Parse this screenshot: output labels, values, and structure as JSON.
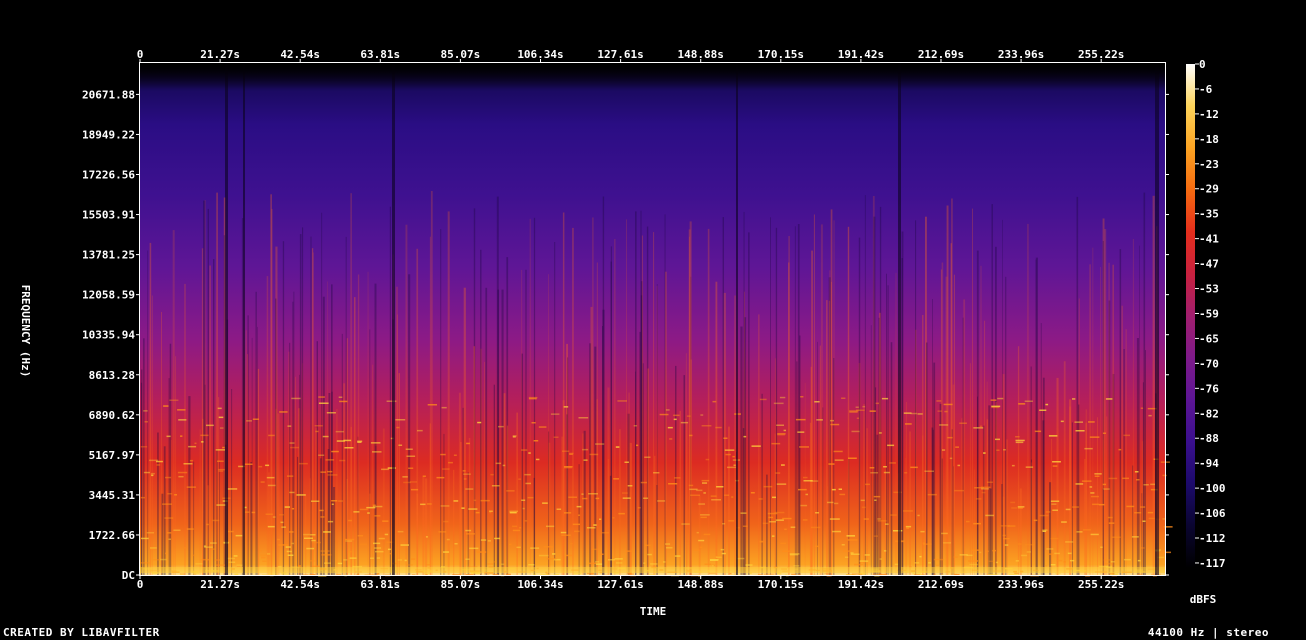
{
  "chart_data": {
    "type": "heatmap",
    "subtype": "spectrogram",
    "xlabel": "TIME",
    "ylabel": "FREQUENCY (Hz)",
    "colorbar_label": "dBFS",
    "x_ticks": [
      "0",
      "21.27s",
      "42.54s",
      "63.81s",
      "85.07s",
      "106.34s",
      "127.61s",
      "148.88s",
      "170.15s",
      "191.42s",
      "212.69s",
      "233.96s",
      "255.22s"
    ],
    "y_ticks": [
      "DC",
      "1722.66",
      "3445.31",
      "5167.97",
      "6890.62",
      "8613.28",
      "10335.94",
      "12058.59",
      "13781.25",
      "15503.91",
      "17226.56",
      "18949.22",
      "20671.88"
    ],
    "y_range": [
      0,
      22050
    ],
    "colorbar_ticks": [
      "0",
      "-6",
      "-12",
      "-18",
      "-23",
      "-29",
      "-35",
      "-41",
      "-47",
      "-53",
      "-59",
      "-65",
      "-70",
      "-76",
      "-82",
      "-88",
      "-94",
      "-100",
      "-106",
      "-112",
      "-117"
    ],
    "colorbar_range": [
      -117,
      0
    ],
    "colormap": [
      "#000000",
      "#0a0530",
      "#1c0a6b",
      "#3a0f8e",
      "#5c1595",
      "#7e1a8a",
      "#a11e6e",
      "#c8213f",
      "#e52e1c",
      "#f56a10",
      "#fca322",
      "#fdd45a",
      "#ffffff"
    ]
  },
  "footer": {
    "created_by": "CREATED BY LIBAVFILTER",
    "audio_info": "44100 Hz | stereo"
  }
}
